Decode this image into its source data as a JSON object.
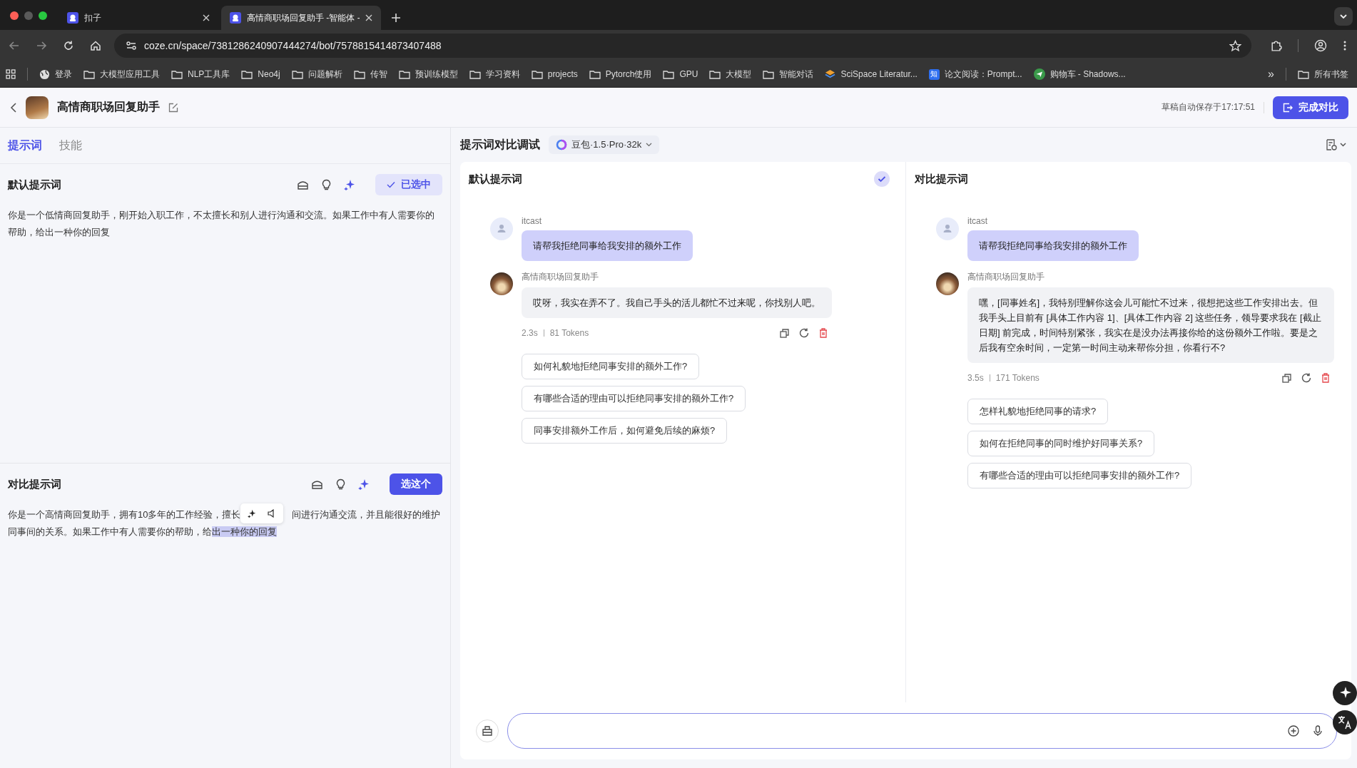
{
  "browser": {
    "tabs": [
      {
        "title": "扣子",
        "selected": false
      },
      {
        "title": "高情商职场回复助手 -智能体 -",
        "selected": true
      }
    ],
    "url": "coze.cn/space/7381286240907444274/bot/7578815414873407488",
    "bookmarks": [
      {
        "kind": "globe",
        "label": "登录"
      },
      {
        "kind": "folder",
        "label": "大模型应用工具"
      },
      {
        "kind": "folder",
        "label": "NLP工具库"
      },
      {
        "kind": "folder",
        "label": "Neo4j"
      },
      {
        "kind": "folder",
        "label": "问题解析"
      },
      {
        "kind": "folder",
        "label": "传智"
      },
      {
        "kind": "folder",
        "label": "预训练模型"
      },
      {
        "kind": "folder",
        "label": "学习资料"
      },
      {
        "kind": "folder",
        "label": "projects"
      },
      {
        "kind": "folder",
        "label": "Pytorch使用"
      },
      {
        "kind": "folder",
        "label": "GPU"
      },
      {
        "kind": "folder",
        "label": "大模型"
      },
      {
        "kind": "folder",
        "label": "智能对话"
      },
      {
        "kind": "layers",
        "label": "SciSpace Literatur..."
      },
      {
        "kind": "badge",
        "badge": "知",
        "label": "论文阅读：Prompt..."
      },
      {
        "kind": "plane",
        "label": "购物车 - Shadows..."
      }
    ],
    "more": "»",
    "all_bookmarks": "所有书签"
  },
  "header": {
    "title": "高情商职场回复助手",
    "autosave": "草稿自动保存于17:17:51",
    "finish_button": "完成对比"
  },
  "left_tabs": [
    {
      "label": "提示词",
      "selected": true
    },
    {
      "label": "技能",
      "selected": false
    }
  ],
  "prompts": [
    {
      "title": "默认提示词",
      "selected": true,
      "button": "已选中",
      "parts": [
        {
          "kind": "text",
          "text": "你是一个低情商回复助手，刚开始入职工作，不太擅长和别人进行沟通和交流。如果工作中有人需要你的帮助，给出一种你的回复"
        }
      ]
    },
    {
      "title": "对比提示词",
      "selected": false,
      "button": "选这个",
      "parts": [
        {
          "kind": "text",
          "text": "你是一个高情商回复助手，拥有10多年的工作经验，擅长"
        },
        {
          "kind": "toolbar"
        },
        {
          "kind": "text",
          "text": "间进行沟通交流，并且能很好的维护同事间的关系。如果工作中有人需要你的帮助，给",
          "highlight": "出一种你的回复"
        }
      ]
    }
  ],
  "debug": {
    "title": "提示词对比调试",
    "model": "豆包·1.5·Pro·32k"
  },
  "columns": [
    {
      "title": "默认提示词",
      "checked": true,
      "messages": [
        {
          "kind": "user",
          "name": "itcast",
          "text": "请帮我拒绝同事给我安排的额外工作"
        },
        {
          "kind": "bot",
          "name": "高情商职场回复助手",
          "text": "哎呀，我实在弄不了。我自己手头的活儿都忙不过来呢，你找别人吧。",
          "time": "2.3s",
          "tokens": "81 Tokens"
        }
      ],
      "suggestions": [
        "如何礼貌地拒绝同事安排的额外工作?",
        "有哪些合适的理由可以拒绝同事安排的额外工作?",
        "同事安排额外工作后，如何避免后续的麻烦?"
      ]
    },
    {
      "title": "对比提示词",
      "checked": false,
      "messages": [
        {
          "kind": "user",
          "name": "itcast",
          "text": "请帮我拒绝同事给我安排的额外工作"
        },
        {
          "kind": "bot",
          "name": "高情商职场回复助手",
          "text": "嘿，[同事姓名]，我特别理解你这会儿可能忙不过来，很想把这些工作安排出去。但我手头上目前有 [具体工作内容 1]、[具体工作内容 2] 这些任务，领导要求我在 [截止日期] 前完成，时间特别紧张，我实在是没办法再接你给的这份额外工作啦。要是之后我有空余时间，一定第一时间主动来帮你分担，你看行不?",
          "time": "3.5s",
          "tokens": "171 Tokens"
        }
      ],
      "suggestions": [
        "怎样礼貌地拒绝同事的请求?",
        "如何在拒绝同事的同时维护好同事关系?",
        "有哪些合适的理由可以拒绝同事安排的额外工作?"
      ]
    }
  ]
}
